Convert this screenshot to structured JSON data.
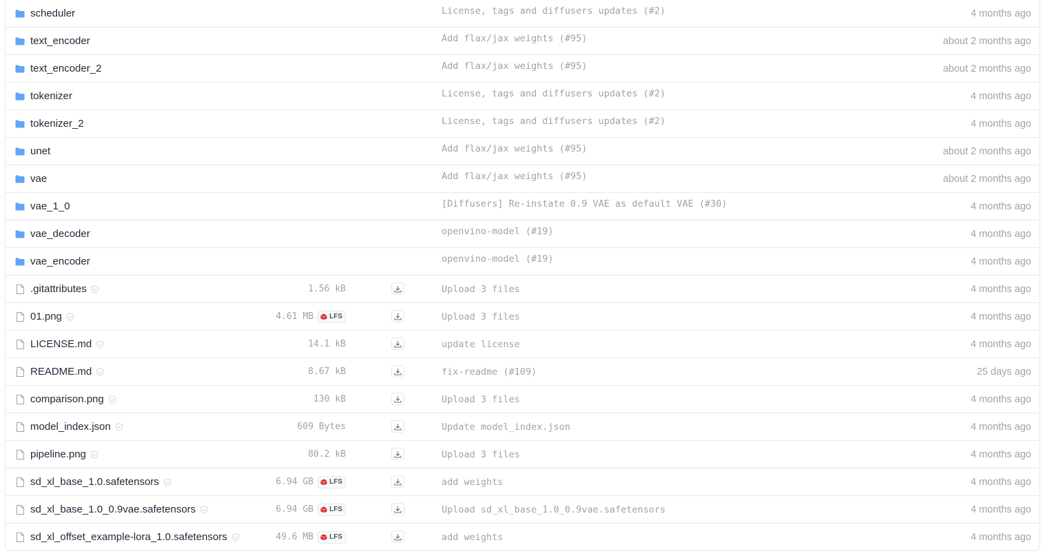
{
  "colors": {
    "folder_icon": "#60a5fa",
    "file_icon": "#9ca3af",
    "lfs_icon": "#dc2626",
    "muted_text": "#9ca3af",
    "border": "#e5e7eb"
  },
  "folders": [
    {
      "name": "scheduler",
      "commit": "License, tags and diffusers updates (#2)",
      "date": "4 months ago"
    },
    {
      "name": "text_encoder",
      "commit": "Add flax/jax weights (#95)",
      "date": "about 2 months ago"
    },
    {
      "name": "text_encoder_2",
      "commit": "Add flax/jax weights (#95)",
      "date": "about 2 months ago"
    },
    {
      "name": "tokenizer",
      "commit": "License, tags and diffusers updates (#2)",
      "date": "4 months ago"
    },
    {
      "name": "tokenizer_2",
      "commit": "License, tags and diffusers updates (#2)",
      "date": "4 months ago"
    },
    {
      "name": "unet",
      "commit": "Add flax/jax weights (#95)",
      "date": "about 2 months ago"
    },
    {
      "name": "vae",
      "commit": "Add flax/jax weights (#95)",
      "date": "about 2 months ago"
    },
    {
      "name": "vae_1_0",
      "commit": "[Diffusers] Re-instate 0.9 VAE as default VAE (#30)",
      "date": "4 months ago"
    },
    {
      "name": "vae_decoder",
      "commit": "openvino-model (#19)",
      "date": "4 months ago"
    },
    {
      "name": "vae_encoder",
      "commit": "openvino-model (#19)",
      "date": "4 months ago"
    }
  ],
  "files": [
    {
      "name": ".gitattributes",
      "size": "1.56 kB",
      "lfs": false,
      "commit": "Upload 3 files",
      "date": "4 months ago"
    },
    {
      "name": "01.png",
      "size": "4.61 MB",
      "lfs": true,
      "commit": "Upload 3 files",
      "date": "4 months ago"
    },
    {
      "name": "LICENSE.md",
      "size": "14.1 kB",
      "lfs": false,
      "commit": "update license",
      "date": "4 months ago"
    },
    {
      "name": "README.md",
      "size": "8.67 kB",
      "lfs": false,
      "commit": "fix-readme (#109)",
      "date": "25 days ago"
    },
    {
      "name": "comparison.png",
      "size": "130 kB",
      "lfs": false,
      "commit": "Upload 3 files",
      "date": "4 months ago"
    },
    {
      "name": "model_index.json",
      "size": "609 Bytes",
      "lfs": false,
      "commit": "Update model_index.json",
      "date": "4 months ago"
    },
    {
      "name": "pipeline.png",
      "size": "80.2 kB",
      "lfs": false,
      "commit": "Upload 3 files",
      "date": "4 months ago"
    },
    {
      "name": "sd_xl_base_1.0.safetensors",
      "size": "6.94 GB",
      "lfs": true,
      "commit": "add weights",
      "date": "4 months ago"
    },
    {
      "name": "sd_xl_base_1.0_0.9vae.safetensors",
      "size": "6.94 GB",
      "lfs": true,
      "commit": "Upload sd_xl_base_1.0_0.9vae.safetensors",
      "date": "4 months ago"
    },
    {
      "name": "sd_xl_offset_example-lora_1.0.safetensors",
      "size": "49.6 MB",
      "lfs": true,
      "commit": "add weights",
      "date": "4 months ago"
    }
  ],
  "lfs_label": "LFS"
}
